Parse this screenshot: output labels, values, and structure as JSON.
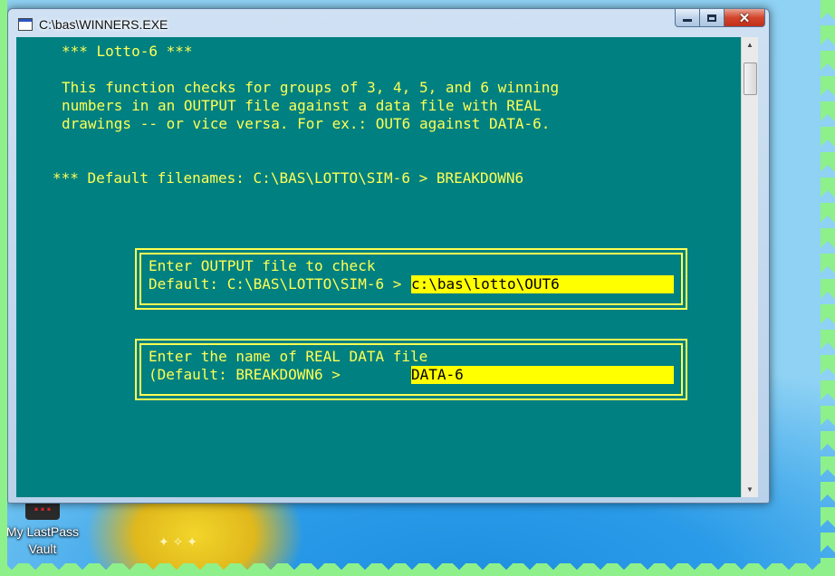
{
  "window": {
    "title": "C:\\bas\\WINNERS.EXE",
    "minimize_label": "",
    "close_label": "✕"
  },
  "console": {
    "header": "*** Lotto-6 ***",
    "desc_line1": "This function checks for groups of 3, 4, 5, and 6 winning",
    "desc_line2": "numbers in an OUTPUT file against a data file with REAL",
    "desc_line3": "drawings -- or vice versa. For ex.: OUT6 against DATA-6.",
    "defaults_line": "*** Default filenames: C:\\BAS\\LOTTO\\SIM-6 > BREAKDOWN6",
    "output_prompt": {
      "line1": "Enter OUTPUT file to check",
      "line2": "Default: C:\\BAS\\LOTTO\\SIM-6 >",
      "value": "c:\\bas\\lotto\\OUT6"
    },
    "data_prompt": {
      "line1": "Enter the name of REAL DATA file",
      "line2": "(Default: BREAKDOWN6 >",
      "value": "DATA-6"
    }
  },
  "desktop": {
    "icon_label_line1": "My LastPass",
    "icon_label_line2": "Vault"
  },
  "colors": {
    "console_bg": "#008080",
    "console_text": "#ffff55",
    "input_bg": "#ffff00"
  }
}
